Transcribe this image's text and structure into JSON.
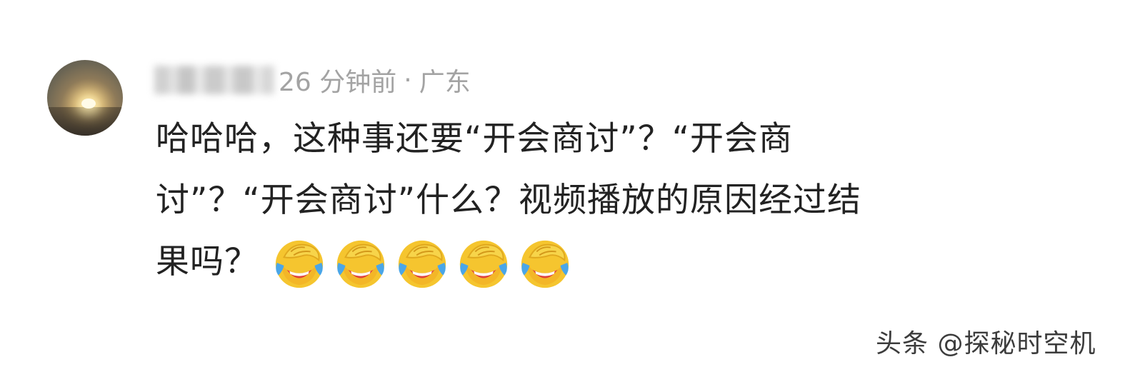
{
  "comment": {
    "author_name": "",
    "timestamp": "26 分钟前",
    "separator": "·",
    "location": "广东",
    "lines": [
      "哈哈哈，这种事还要“开会商讨”？“开会商",
      "讨”？“开会商讨”什么？视频播放的原因经过结",
      "果吗？"
    ],
    "emojis": [
      "facepalm-laughing-emoji",
      "facepalm-laughing-emoji",
      "facepalm-laughing-emoji",
      "facepalm-laughing-emoji",
      "facepalm-laughing-emoji"
    ]
  },
  "watermark": {
    "text": "头条 @探秘时空机"
  },
  "colors": {
    "text_primary": "#222222",
    "text_meta": "#a3a3a3",
    "emoji_face": "#f5c52f",
    "emoji_tears": "#4aa6e8"
  }
}
